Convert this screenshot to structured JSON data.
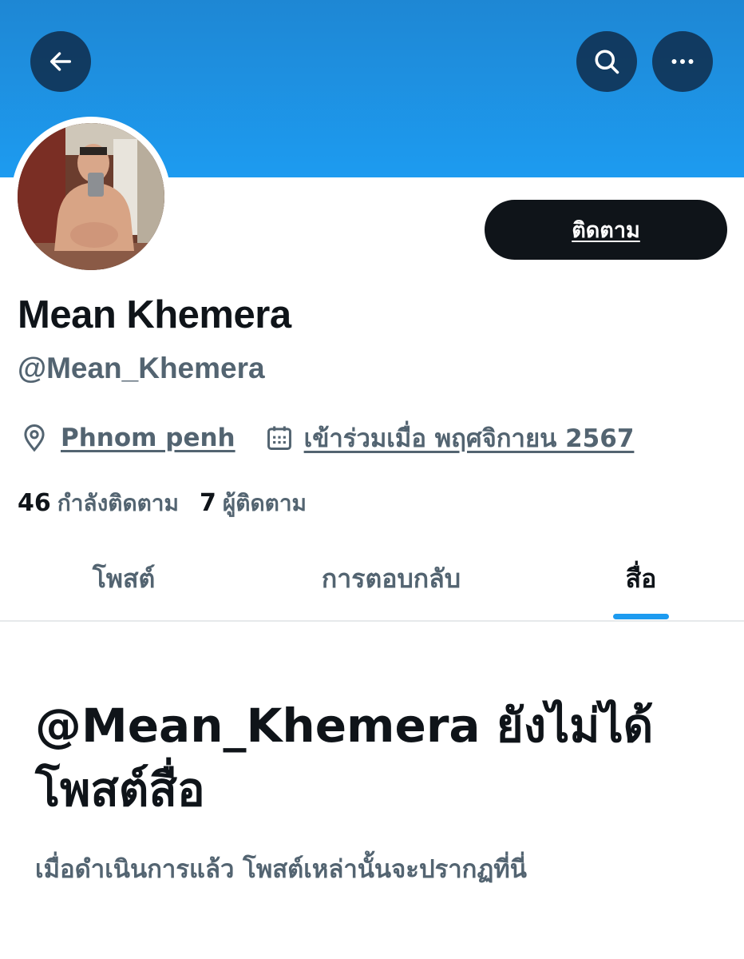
{
  "header": {
    "back_icon": "arrow-left-icon",
    "search_icon": "search-icon",
    "more_icon": "more-horizontal-icon",
    "banner_color": "#1d9bf0"
  },
  "profile": {
    "display_name": "Mean Khemera",
    "handle": "@Mean_Khemera",
    "follow_label": "ติดตาม",
    "location": "Phnom penh",
    "joined": "เข้าร่วมเมื่อ พฤศจิกายน 2567",
    "following_count": "46",
    "following_label": "กำลังติดตาม",
    "followers_count": "7",
    "followers_label": "ผู้ติดตาม"
  },
  "tabs": [
    {
      "label": "โพสต์",
      "active": false
    },
    {
      "label": "การตอบกลับ",
      "active": false
    },
    {
      "label": "สื่อ",
      "active": true
    }
  ],
  "empty_state": {
    "title": "@Mean_Khemera ยังไม่ได้โพสต์สื่อ",
    "subtitle": "เมื่อดำเนินการแล้ว โพสต์เหล่านั้นจะปรากฏที่นี่"
  },
  "colors": {
    "accent": "#1d9bf0",
    "text_primary": "#0f1419",
    "text_secondary": "#536471"
  }
}
